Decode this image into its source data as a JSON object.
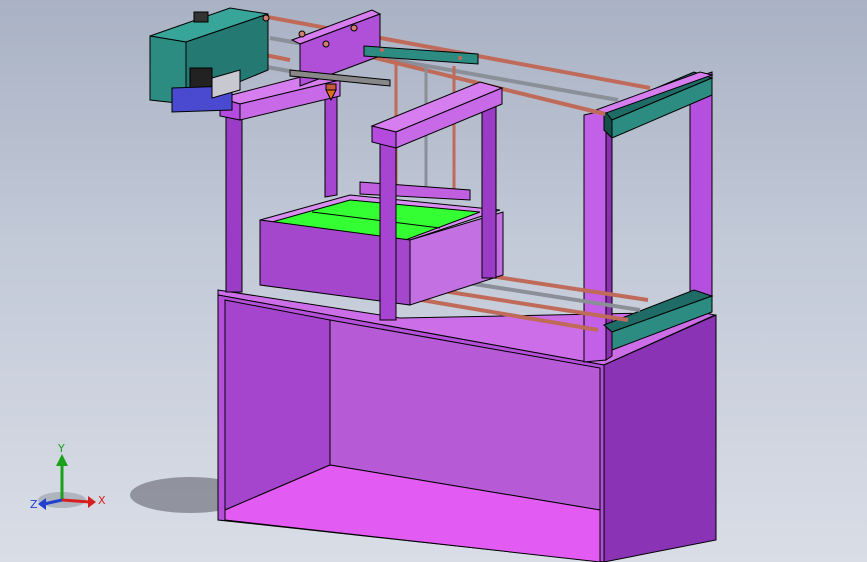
{
  "triad": {
    "x_label": "X",
    "y_label": "Y",
    "z_label": "Z",
    "x_color": "#d62020",
    "y_color": "#1aa01a",
    "z_color": "#2040d0"
  },
  "colors": {
    "frame_purple": "#b24fd6",
    "frame_dark": "#7b2aa0",
    "frame_light": "#d67ef0",
    "teal": "#2d8c82",
    "green_bed": "#33ff33",
    "rod_red": "#c06a5a",
    "rod_gray": "#8a8f98"
  }
}
